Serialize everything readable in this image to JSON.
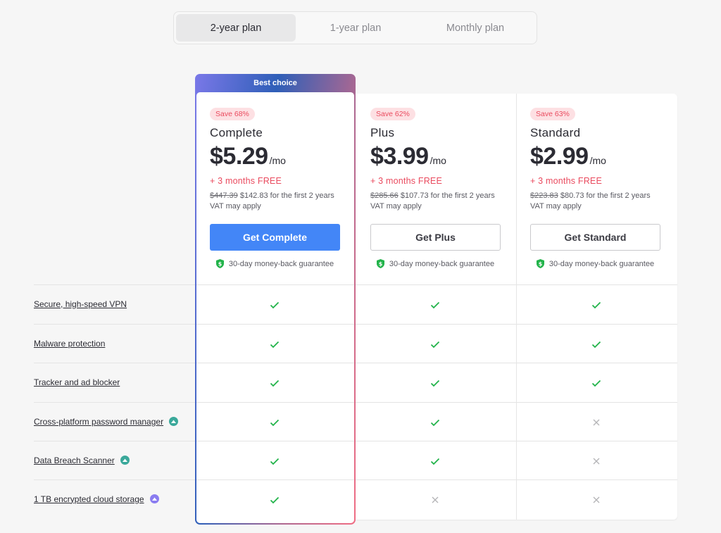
{
  "period_tabs": [
    {
      "label": "2-year plan",
      "active": true
    },
    {
      "label": "1-year plan",
      "active": false
    },
    {
      "label": "Monthly plan",
      "active": false
    }
  ],
  "featured_label": "Best choice",
  "plans": [
    {
      "save": "Save 68%",
      "name": "Complete",
      "price": "$5.29",
      "per": "/mo",
      "bonus": "+ 3 months FREE",
      "old_total": "$447.39",
      "new_total": "$142.83 for the first 2 years",
      "vat": "VAT may apply",
      "cta": "Get Complete",
      "guarantee": "30-day money-back guarantee"
    },
    {
      "save": "Save 62%",
      "name": "Plus",
      "price": "$3.99",
      "per": "/mo",
      "bonus": "+ 3 months FREE",
      "old_total": "$285.66",
      "new_total": "$107.73 for the first 2 years",
      "vat": "VAT may apply",
      "cta": "Get Plus",
      "guarantee": "30-day money-back guarantee"
    },
    {
      "save": "Save 63%",
      "name": "Standard",
      "price": "$2.99",
      "per": "/mo",
      "bonus": "+ 3 months FREE",
      "old_total": "$223.83",
      "new_total": "$80.73 for the first 2 years",
      "vat": "VAT may apply",
      "cta": "Get Standard",
      "guarantee": "30-day money-back guarantee"
    }
  ],
  "features": [
    {
      "label": "Secure, high-speed VPN",
      "badge": null,
      "included": [
        true,
        true,
        true
      ]
    },
    {
      "label": "Malware protection",
      "badge": null,
      "included": [
        true,
        true,
        true
      ]
    },
    {
      "label": "Tracker and ad blocker",
      "badge": null,
      "included": [
        true,
        true,
        true
      ]
    },
    {
      "label": "Cross-platform password manager",
      "badge": "teal-product-icon",
      "included": [
        true,
        true,
        false
      ]
    },
    {
      "label": "Data Breach Scanner",
      "badge": "teal-product-icon",
      "included": [
        true,
        true,
        false
      ]
    },
    {
      "label": "1 TB encrypted cloud storage",
      "badge": "purple-product-icon",
      "included": [
        true,
        false,
        false
      ]
    }
  ],
  "colors": {
    "primary": "#4386f7",
    "accent_red": "#ea4a5e",
    "check_green": "#22b34a",
    "cross_gray": "#b5b5b8",
    "teal_badge": "#3aa89a",
    "purple_badge": "#8a7cf0"
  }
}
